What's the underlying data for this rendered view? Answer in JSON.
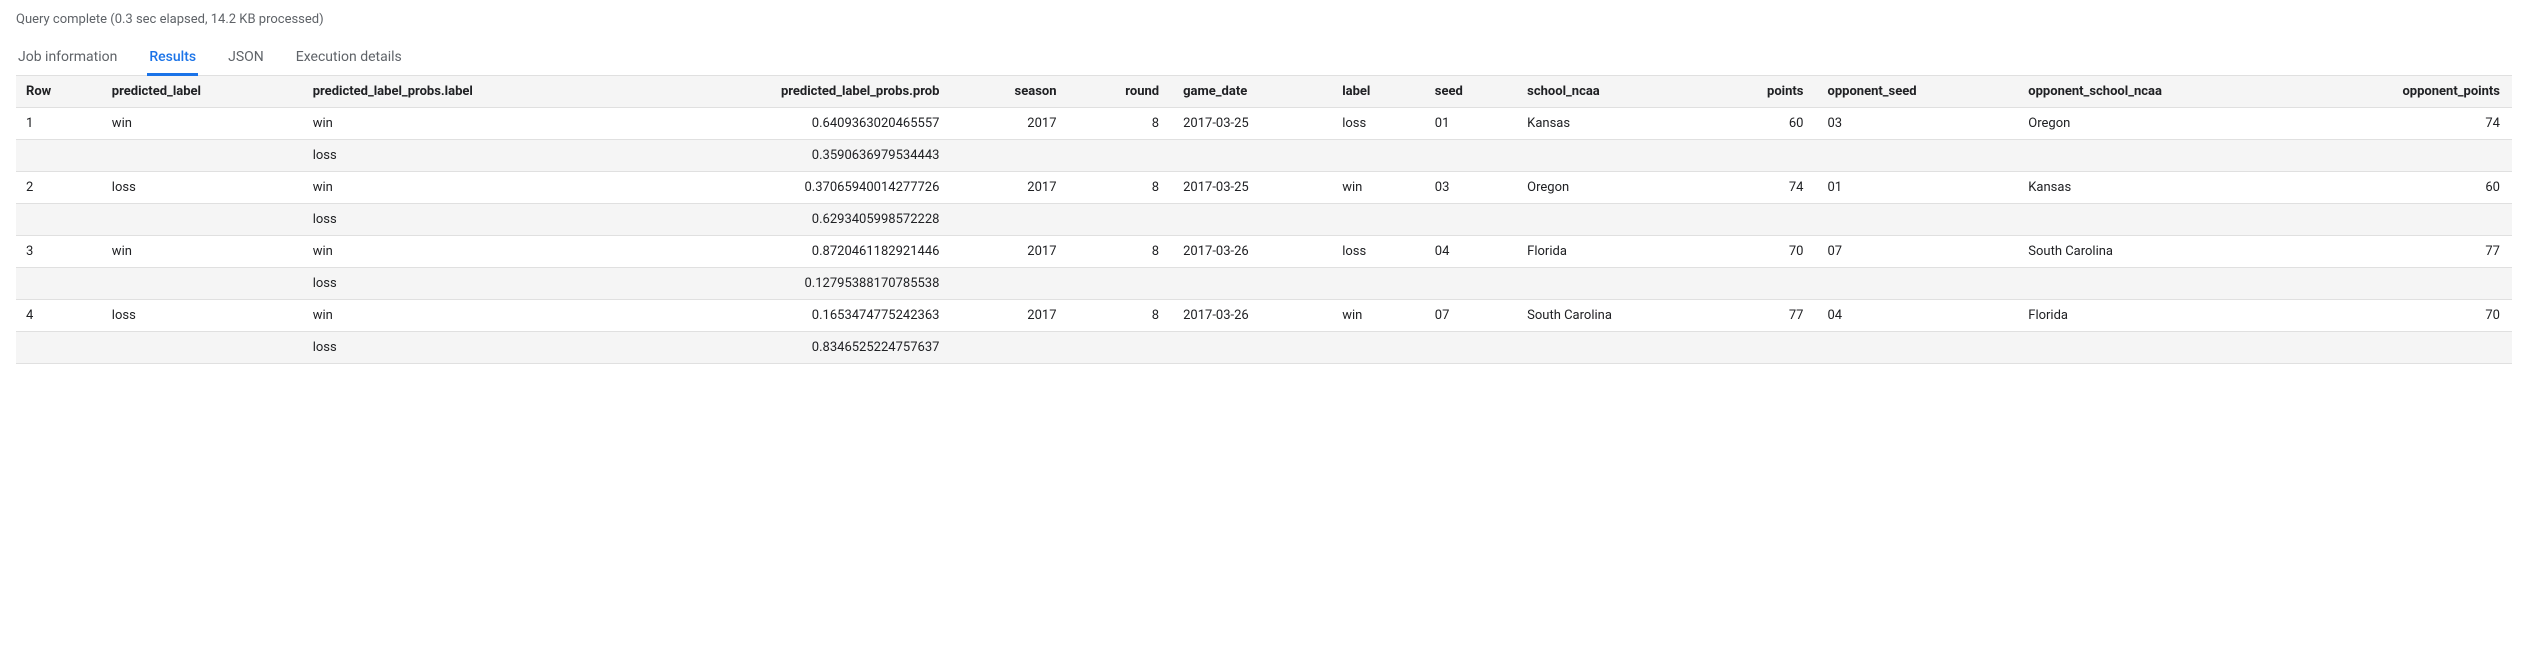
{
  "status": "Query complete (0.3 sec elapsed, 14.2 KB processed)",
  "tabs": {
    "job_info": "Job information",
    "results": "Results",
    "json": "JSON",
    "exec": "Execution details"
  },
  "columns": {
    "row": "Row",
    "predicted_label": "predicted_label",
    "predicted_label_probs_label": "predicted_label_probs.label",
    "predicted_label_probs_prob": "predicted_label_probs.prob",
    "season": "season",
    "round": "round",
    "game_date": "game_date",
    "label": "label",
    "seed": "seed",
    "school_ncaa": "school_ncaa",
    "points": "points",
    "opponent_seed": "opponent_seed",
    "opponent_school_ncaa": "opponent_school_ncaa",
    "opponent_points": "opponent_points"
  },
  "rows": [
    {
      "row": "1",
      "predicted_label": "win",
      "probs": [
        {
          "label": "win",
          "prob": "0.6409363020465557"
        },
        {
          "label": "loss",
          "prob": "0.3590636979534443"
        }
      ],
      "season": "2017",
      "round": "8",
      "game_date": "2017-03-25",
      "label": "loss",
      "seed": "01",
      "school_ncaa": "Kansas",
      "points": "60",
      "opponent_seed": "03",
      "opponent_school_ncaa": "Oregon",
      "opponent_points": "74"
    },
    {
      "row": "2",
      "predicted_label": "loss",
      "probs": [
        {
          "label": "win",
          "prob": "0.37065940014277726"
        },
        {
          "label": "loss",
          "prob": "0.6293405998572228"
        }
      ],
      "season": "2017",
      "round": "8",
      "game_date": "2017-03-25",
      "label": "win",
      "seed": "03",
      "school_ncaa": "Oregon",
      "points": "74",
      "opponent_seed": "01",
      "opponent_school_ncaa": "Kansas",
      "opponent_points": "60"
    },
    {
      "row": "3",
      "predicted_label": "win",
      "probs": [
        {
          "label": "win",
          "prob": "0.8720461182921446"
        },
        {
          "label": "loss",
          "prob": "0.12795388170785538"
        }
      ],
      "season": "2017",
      "round": "8",
      "game_date": "2017-03-26",
      "label": "loss",
      "seed": "04",
      "school_ncaa": "Florida",
      "points": "70",
      "opponent_seed": "07",
      "opponent_school_ncaa": "South Carolina",
      "opponent_points": "77"
    },
    {
      "row": "4",
      "predicted_label": "loss",
      "probs": [
        {
          "label": "win",
          "prob": "0.1653474775242363"
        },
        {
          "label": "loss",
          "prob": "0.8346525224757637"
        }
      ],
      "season": "2017",
      "round": "8",
      "game_date": "2017-03-26",
      "label": "win",
      "seed": "07",
      "school_ncaa": "South Carolina",
      "points": "77",
      "opponent_seed": "04",
      "opponent_school_ncaa": "Florida",
      "opponent_points": "70"
    }
  ]
}
